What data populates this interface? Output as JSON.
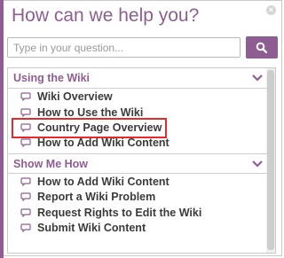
{
  "header": {
    "title": "How can we help you?"
  },
  "search": {
    "placeholder": "Type in your question..."
  },
  "sections": [
    {
      "title": "Using the Wiki",
      "items": [
        {
          "label": "Wiki Overview"
        },
        {
          "label": "How to Use the Wiki"
        },
        {
          "label": "Country Page Overview",
          "highlighted": true
        },
        {
          "label": "How to Add Wiki Content"
        }
      ]
    },
    {
      "title": "Show Me How",
      "items": [
        {
          "label": "How to Add Wiki Content"
        },
        {
          "label": "Report a Wiki Problem"
        },
        {
          "label": "Request Rights to Edit the Wiki"
        },
        {
          "label": "Submit Wiki Content"
        }
      ]
    }
  ],
  "colors": {
    "accent": "#8e5d91",
    "highlight": "#e32b2b",
    "text": "#3b3b3b"
  },
  "icons": {
    "close": "close-icon",
    "search": "search-icon",
    "expand": "chevron-down-icon",
    "item": "speech-bubble-icon"
  }
}
